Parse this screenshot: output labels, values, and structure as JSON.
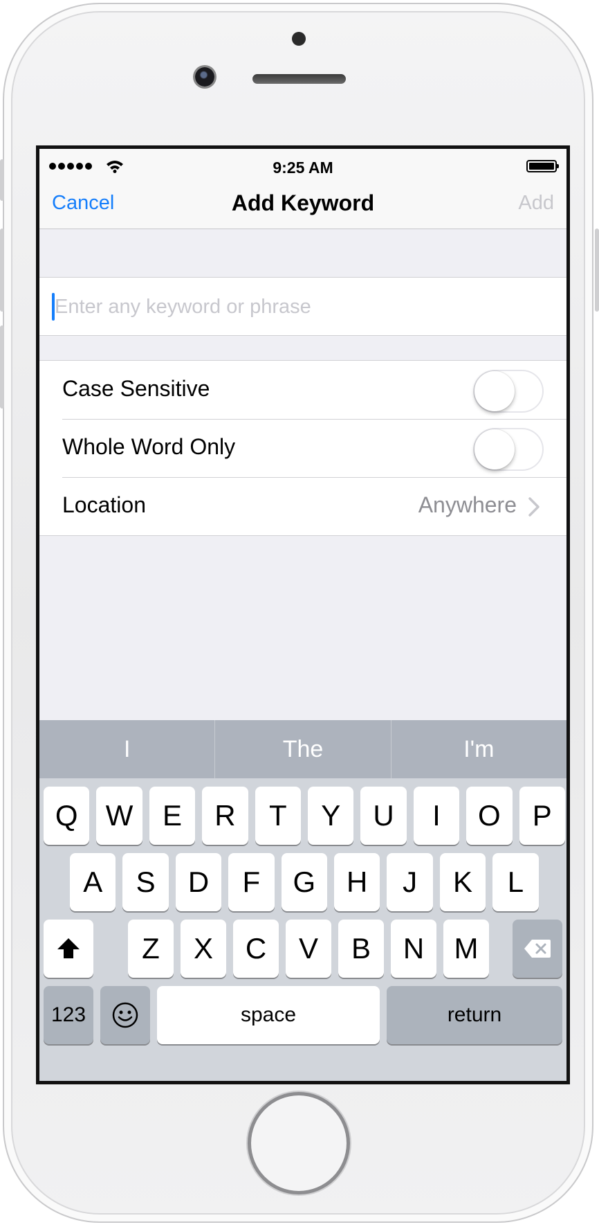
{
  "status_bar": {
    "time": "9:25 AM"
  },
  "nav": {
    "cancel_label": "Cancel",
    "title": "Add Keyword",
    "add_label": "Add"
  },
  "keyword_field": {
    "value": "",
    "placeholder": "Enter any keyword or phrase"
  },
  "options": {
    "case_sensitive": {
      "label": "Case Sensitive",
      "on": false
    },
    "whole_word_only": {
      "label": "Whole Word Only",
      "on": false
    },
    "location": {
      "label": "Location",
      "value": "Anywhere"
    }
  },
  "keyboard": {
    "suggestions": [
      "I",
      "The",
      "I'm"
    ],
    "row1": [
      "Q",
      "W",
      "E",
      "R",
      "T",
      "Y",
      "U",
      "I",
      "O",
      "P"
    ],
    "row2": [
      "A",
      "S",
      "D",
      "F",
      "G",
      "H",
      "J",
      "K",
      "L"
    ],
    "row3": [
      "Z",
      "X",
      "C",
      "V",
      "B",
      "N",
      "M"
    ],
    "numbers_label": "123",
    "space_label": "space",
    "return_label": "return"
  },
  "icons": {
    "signal": "signal-dots-icon",
    "wifi": "wifi-icon",
    "battery": "battery-icon",
    "chevron": "chevron-right-icon",
    "shift": "shift-icon",
    "delete": "delete-icon",
    "emoji": "emoji-icon"
  },
  "colors": {
    "accent": "#157efb",
    "disabled": "#c7c7cc",
    "secondary_text": "#8e8e93",
    "keyboard_bg": "#d1d5db",
    "suggestion_bar": "#adb3bd"
  }
}
